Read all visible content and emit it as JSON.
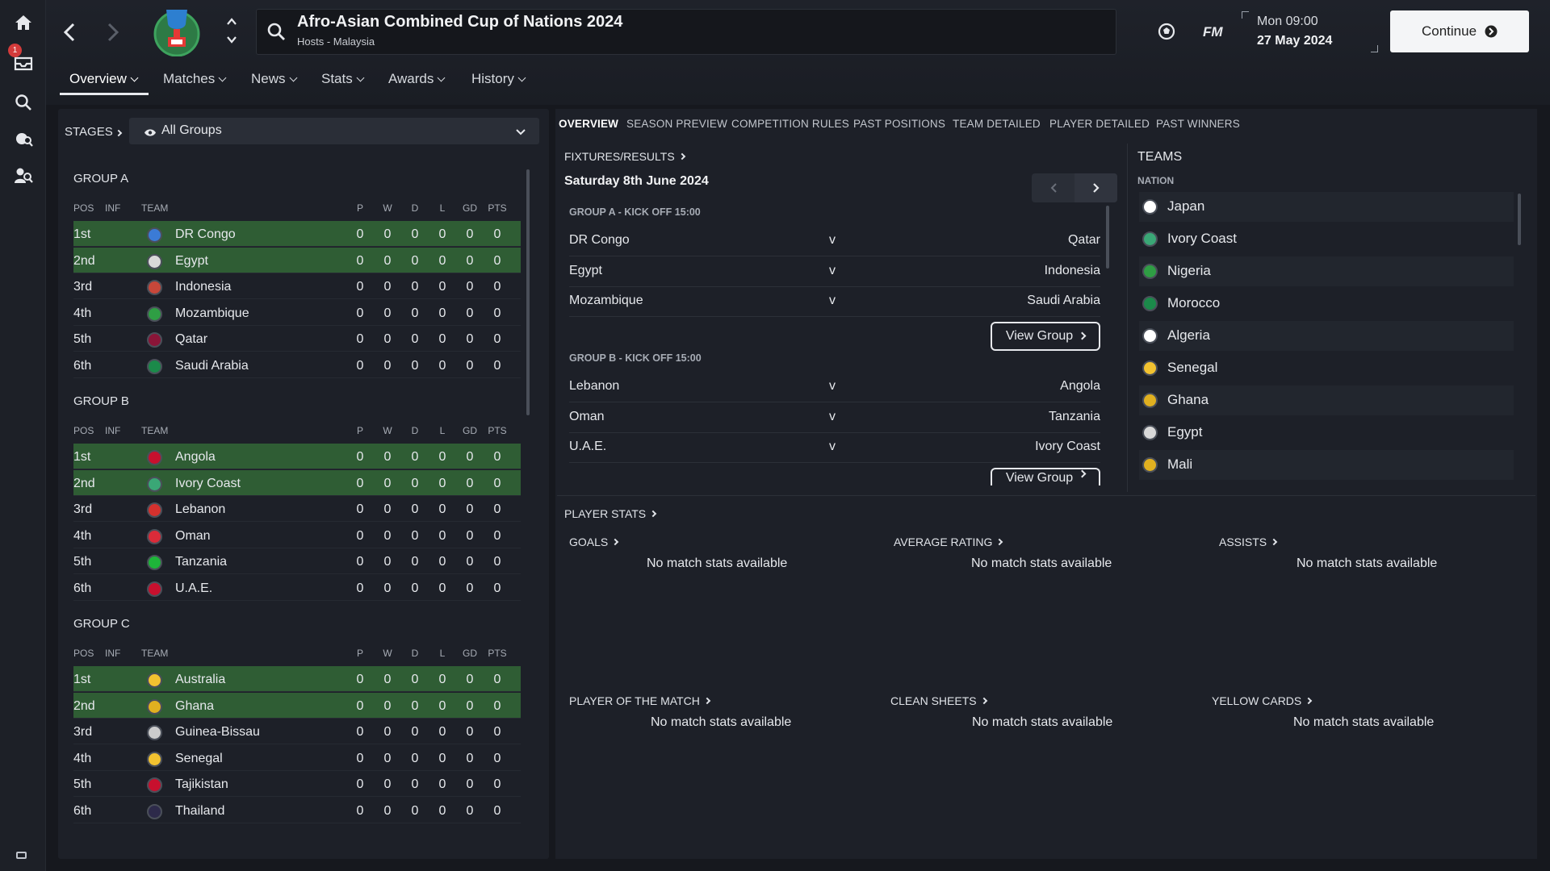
{
  "sidebar": {
    "items": [
      "home-icon",
      "inbox-icon",
      "search-icon",
      "scouting-icon",
      "staff-search-icon"
    ],
    "inbox_badge": "1"
  },
  "header": {
    "title": "Afro-Asian Combined Cup of Nations 2024",
    "subtitle": "Hosts - Malaysia",
    "date_line1": "Mon 09:00",
    "date_line2": "27 May 2024",
    "fm_label": "FM",
    "continue_label": "Continue"
  },
  "tabs": [
    {
      "label": "Overview"
    },
    {
      "label": "Matches"
    },
    {
      "label": "News"
    },
    {
      "label": "Stats"
    },
    {
      "label": "Awards"
    },
    {
      "label": "History"
    }
  ],
  "left": {
    "stages_label": "STAGES",
    "select_value": "All Groups",
    "columns": [
      "POS",
      "INF",
      "TEAM",
      "P",
      "W",
      "D",
      "L",
      "GD",
      "PTS"
    ],
    "groups": [
      {
        "name": "GROUP A",
        "rows": [
          {
            "pos": "1st",
            "team": "DR Congo",
            "p": "0",
            "w": "0",
            "d": "0",
            "l": "0",
            "gd": "0",
            "pts": "0",
            "color": "#3b7bd6"
          },
          {
            "pos": "2nd",
            "team": "Egypt",
            "p": "0",
            "w": "0",
            "d": "0",
            "l": "0",
            "gd": "0",
            "pts": "0",
            "color": "#d9d9d9"
          },
          {
            "pos": "3rd",
            "team": "Indonesia",
            "p": "0",
            "w": "0",
            "d": "0",
            "l": "0",
            "gd": "0",
            "pts": "0",
            "color": "#c8473a"
          },
          {
            "pos": "4th",
            "team": "Mozambique",
            "p": "0",
            "w": "0",
            "d": "0",
            "l": "0",
            "gd": "0",
            "pts": "0",
            "color": "#2f9e44"
          },
          {
            "pos": "5th",
            "team": "Qatar",
            "p": "0",
            "w": "0",
            "d": "0",
            "l": "0",
            "gd": "0",
            "pts": "0",
            "color": "#8a1538"
          },
          {
            "pos": "6th",
            "team": "Saudi Arabia",
            "p": "0",
            "w": "0",
            "d": "0",
            "l": "0",
            "gd": "0",
            "pts": "0",
            "color": "#1b8a4a"
          }
        ]
      },
      {
        "name": "GROUP B",
        "rows": [
          {
            "pos": "1st",
            "team": "Angola",
            "p": "0",
            "w": "0",
            "d": "0",
            "l": "0",
            "gd": "0",
            "pts": "0",
            "color": "#c8102e"
          },
          {
            "pos": "2nd",
            "team": "Ivory Coast",
            "p": "0",
            "w": "0",
            "d": "0",
            "l": "0",
            "gd": "0",
            "pts": "0",
            "color": "#3aa776"
          },
          {
            "pos": "3rd",
            "team": "Lebanon",
            "p": "0",
            "w": "0",
            "d": "0",
            "l": "0",
            "gd": "0",
            "pts": "0",
            "color": "#d4312e"
          },
          {
            "pos": "4th",
            "team": "Oman",
            "p": "0",
            "w": "0",
            "d": "0",
            "l": "0",
            "gd": "0",
            "pts": "0",
            "color": "#db2b39"
          },
          {
            "pos": "5th",
            "team": "Tanzania",
            "p": "0",
            "w": "0",
            "d": "0",
            "l": "0",
            "gd": "0",
            "pts": "0",
            "color": "#1eb53a"
          },
          {
            "pos": "6th",
            "team": "U.A.E.",
            "p": "0",
            "w": "0",
            "d": "0",
            "l": "0",
            "gd": "0",
            "pts": "0",
            "color": "#c8102e"
          }
        ]
      },
      {
        "name": "GROUP C",
        "rows": [
          {
            "pos": "1st",
            "team": "Australia",
            "p": "0",
            "w": "0",
            "d": "0",
            "l": "0",
            "gd": "0",
            "pts": "0",
            "color": "#f2c230"
          },
          {
            "pos": "2nd",
            "team": "Ghana",
            "p": "0",
            "w": "0",
            "d": "0",
            "l": "0",
            "gd": "0",
            "pts": "0",
            "color": "#e0b020"
          },
          {
            "pos": "3rd",
            "team": "Guinea-Bissau",
            "p": "0",
            "w": "0",
            "d": "0",
            "l": "0",
            "gd": "0",
            "pts": "0",
            "color": "#cccccc"
          },
          {
            "pos": "4th",
            "team": "Senegal",
            "p": "0",
            "w": "0",
            "d": "0",
            "l": "0",
            "gd": "0",
            "pts": "0",
            "color": "#f2c230"
          },
          {
            "pos": "5th",
            "team": "Tajikistan",
            "p": "0",
            "w": "0",
            "d": "0",
            "l": "0",
            "gd": "0",
            "pts": "0",
            "color": "#c8102e"
          },
          {
            "pos": "6th",
            "team": "Thailand",
            "p": "0",
            "w": "0",
            "d": "0",
            "l": "0",
            "gd": "0",
            "pts": "0",
            "color": "#2d2a4a"
          }
        ]
      }
    ]
  },
  "subtabs": [
    "OVERVIEW",
    "SEASON PREVIEW",
    "COMPETITION RULES",
    "PAST POSITIONS",
    "TEAM DETAILED",
    "PLAYER DETAILED",
    "PAST WINNERS"
  ],
  "fixtures": {
    "title": "FIXTURES/RESULTS",
    "date": "Saturday 8th June 2024",
    "view_group_label": "View Group",
    "groups": [
      {
        "header": "GROUP A - KICK OFF 15:00",
        "matches": [
          {
            "home": "DR Congo",
            "v": "v",
            "away": "Qatar"
          },
          {
            "home": "Egypt",
            "v": "v",
            "away": "Indonesia"
          },
          {
            "home": "Mozambique",
            "v": "v",
            "away": "Saudi Arabia"
          }
        ]
      },
      {
        "header": "GROUP B - KICK OFF 15:00",
        "matches": [
          {
            "home": "Lebanon",
            "v": "v",
            "away": "Angola"
          },
          {
            "home": "Oman",
            "v": "v",
            "away": "Tanzania"
          },
          {
            "home": "U.A.E.",
            "v": "v",
            "away": "Ivory Coast"
          }
        ]
      }
    ]
  },
  "teams": {
    "title": "TEAMS",
    "column": "NATION",
    "list": [
      {
        "name": "Japan",
        "color": "#ffffff"
      },
      {
        "name": "Ivory Coast",
        "color": "#3aa776"
      },
      {
        "name": "Nigeria",
        "color": "#2f9e44"
      },
      {
        "name": "Morocco",
        "color": "#1b8a4a"
      },
      {
        "name": "Algeria",
        "color": "#ffffff"
      },
      {
        "name": "Senegal",
        "color": "#f2c230"
      },
      {
        "name": "Ghana",
        "color": "#e0b020"
      },
      {
        "name": "Egypt",
        "color": "#d9d9d9"
      },
      {
        "name": "Mali",
        "color": "#e0b020"
      }
    ]
  },
  "player_stats": {
    "title": "PLAYER STATS",
    "empty_text": "No match stats available",
    "blocks": [
      "GOALS",
      "AVERAGE RATING",
      "ASSISTS",
      "PLAYER OF THE MATCH",
      "CLEAN SHEETS",
      "YELLOW CARDS"
    ]
  }
}
